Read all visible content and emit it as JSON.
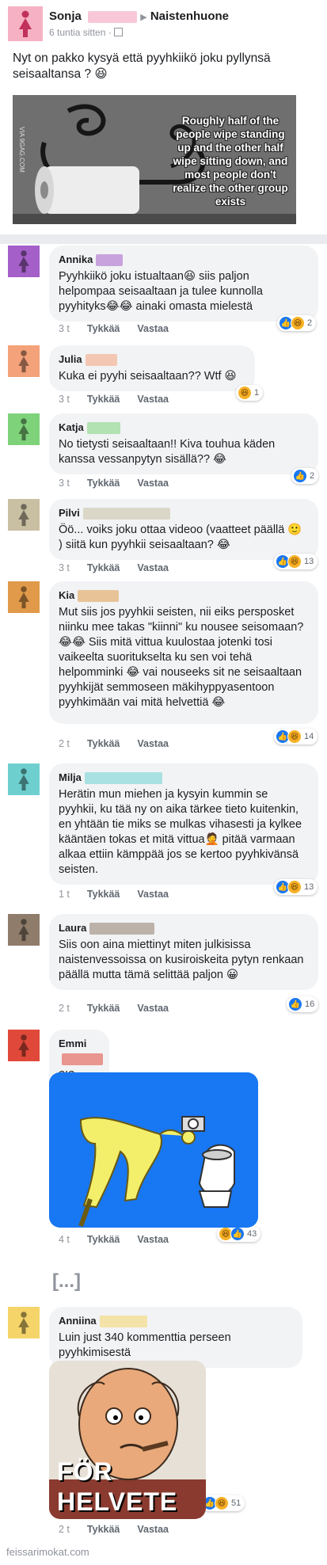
{
  "post": {
    "author": "Sonja",
    "group": "Naistenhuone",
    "time": "6 tuntia sitten ·",
    "text": "Nyt on pakko kysyä että pyyhkiikö joku pyllynsä seisaaltansa ? 😆",
    "meme_text": "Roughly half of the people wipe standing up and the other half wipe sitting down, and most people don't realize the other group exists",
    "meme_watermark": "VIA 9GAG.COM"
  },
  "comments": [
    {
      "name": "Annika",
      "text": "Pyyhkiikö joku istualtaan😆 siis paljon helpompaa seisaaltaan ja tulee kunnolla pyyhityks😂😂 ainaki omasta mielestä",
      "time": "3 t",
      "like": "Tykkää",
      "reply": "Vastaa",
      "count": "2"
    },
    {
      "name": "Julia",
      "text": "Kuka ei pyyhi seisaaltaan?? Wtf 😆",
      "time": "3 t",
      "like": "Tykkää",
      "reply": "Vastaa",
      "count": "1"
    },
    {
      "name": "Katja",
      "text": "No tietysti seisaaltaan!! Kiva touhua käden kanssa vessanpytyn sisällä?? 😂",
      "time": "3 t",
      "like": "Tykkää",
      "reply": "Vastaa",
      "count": "2"
    },
    {
      "name": "Pilvi",
      "text": "Öö... voiks joku ottaa videoo (vaatteet päällä 🙂 ) siitä kun pyyhkii seisaaltaan? 😂",
      "time": "3 t",
      "like": "Tykkää",
      "reply": "Vastaa",
      "count": "13"
    },
    {
      "name": "Kia",
      "text": "Mut siis jos pyyhkii seisten, nii eiks persposket niinku mee takas \"kiinni\" ku nousee seisomaan? 😂😂 Siis mitä vittua kuulostaa jotenki tosi vaikeelta suoritukselta ku sen voi tehä helpomminki 😂 vai nouseeks sit ne seisaaltaan pyyhkijät semmoseen mäkihyppyasentoon pyyhkimään vai mitä helvettiä 😂",
      "time": "2 t",
      "like": "Tykkää",
      "reply": "Vastaa",
      "count": "14"
    },
    {
      "name": "Milja",
      "text": "Herätin mun miehen ja kysyin kummin se pyyhkii, ku tää ny on aika tärkee tieto kuitenkin,  en yhtään tie miks se mulkas vihasesti ja kylkee kääntäen tokas et mitä vittua🤦 pitää varmaan alkaa ettiin kämppää jos se kertoo pyyhkivänsä seisten.",
      "time": "1 t",
      "like": "Tykkää",
      "reply": "Vastaa",
      "count": "13"
    },
    {
      "name": "Laura",
      "text": "Siis oon aina miettinyt miten julkisissa naistenvessoissa on kusiroiskeita pytyn renkaan päällä mutta tämä selittää paljon 😀",
      "time": "2 t",
      "like": "Tykkää",
      "reply": "Vastaa",
      "count": "16"
    },
    {
      "name": "Emmi",
      "text": "?!?",
      "time": "4 t",
      "like": "Tykkää",
      "reply": "Vastaa",
      "count": "43"
    },
    {
      "name": "Anniina",
      "text": "Luin just 340 kommenttia perseen pyyhkimisestä",
      "time": "2 t",
      "like": "Tykkää",
      "reply": "Vastaa",
      "count": "51"
    }
  ],
  "ellipsis": "[...]",
  "helvete": {
    "line1": "FÖR",
    "line2": "HELVETE"
  },
  "footer": "feissarimokat.com",
  "colors": {
    "sonja": "#f6b2c4",
    "annika": "#a55fc9",
    "julia": "#f4a27a",
    "katja": "#7ed27a",
    "pilvi": "#c9bfa2",
    "kia": "#e09a4a",
    "milja": "#6ecfcf",
    "laura": "#8f7c6a",
    "emmi": "#e0493a",
    "anniina": "#f5d56a",
    "drawing_bg": "#1877f2"
  }
}
